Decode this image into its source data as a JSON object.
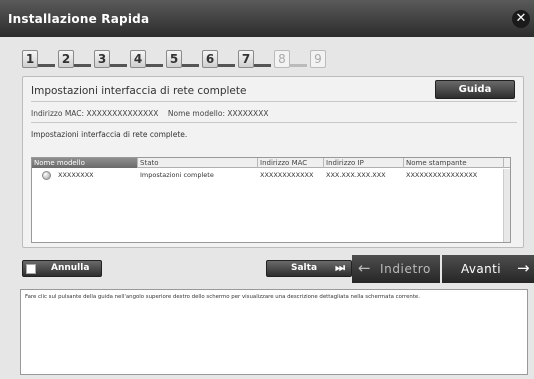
{
  "window": {
    "title": "Installazione Rapida",
    "close_icon": "close-icon"
  },
  "steps": [
    {
      "num": "1",
      "active": true
    },
    {
      "num": "2",
      "active": true
    },
    {
      "num": "3",
      "active": true
    },
    {
      "num": "4",
      "active": true
    },
    {
      "num": "5",
      "active": true
    },
    {
      "num": "6",
      "active": true
    },
    {
      "num": "7",
      "active": true
    },
    {
      "num": "8",
      "active": false
    },
    {
      "num": "9",
      "active": false
    }
  ],
  "panel": {
    "title": "Impostazioni interfaccia di rete complete",
    "guide_label": "Guida",
    "mac_label": "Indirizzo MAC: XXXXXXXXXXXXXX",
    "model_label": "Nome modello: XXXXXXXX",
    "subtitle": "Impostazioni interfaccia di rete complete."
  },
  "table": {
    "headers": [
      "Nome modello",
      "Stato",
      "Indirizzo MAC",
      "Indirizzo IP",
      "Nome stampante"
    ],
    "rows": [
      [
        "XXXXXXXX",
        "Impostazioni complete",
        "XXXXXXXXXXXX",
        "XXX.XXX.XXX.XXX",
        "XXXXXXXXXXXXXXXX"
      ]
    ]
  },
  "buttons": {
    "cancel": "Annulla",
    "skip": "Salta",
    "back": "Indietro",
    "next": "Avanti"
  },
  "help": {
    "text": "Fare clic sul pulsante della guida nell'angolo superiore destro dello schermo per visualizzare una descrizione dettagliata nella schermata corrente."
  }
}
